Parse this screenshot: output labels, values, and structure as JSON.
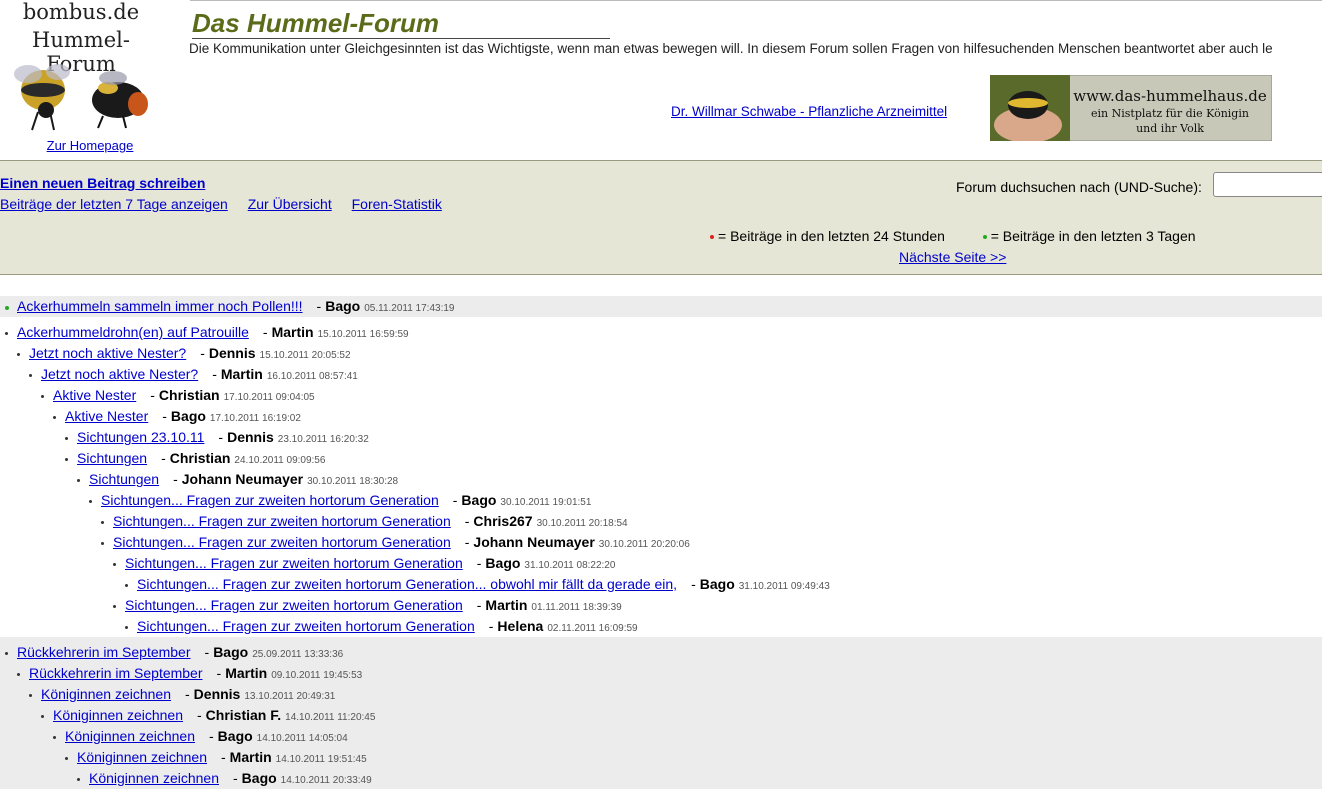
{
  "header": {
    "logo_line1": "bombus.de",
    "logo_line2": "Hummel-Forum",
    "home_link": "Zur Homepage",
    "title": "Das Hummel-Forum",
    "tagline": "Die Kommunikation unter Gleichgesinnten ist das Wichtigste, wenn man etwas bewegen will. In diesem Forum sollen Fragen von hilfesuchenden Menschen beantwortet aber auch le",
    "sponsor_link": "Dr. Willmar Schwabe - Pflanzliche Arzneimittel",
    "banner": {
      "line1": "www.das-hummelhaus.de",
      "line2": "ein Nistplatz für die Königin",
      "line3": "und ihr Volk"
    }
  },
  "toolbar": {
    "new_post": "Einen neuen Beitrag schreiben",
    "last7": "Beiträge der letzten 7 Tage anzeigen",
    "overview": "Zur Übersicht",
    "stats": "Foren-Statistik",
    "search_label": "Forum duchsuchen nach (UND-Suche):",
    "search_value": "",
    "legend_24h": "= Beiträge in den letzten 24 Stunden",
    "legend_3d": "= Beiträge in den letzten 3 Tagen",
    "next_page": "Nächste Seite >>"
  },
  "colors": {
    "new_24h": "#dd2222",
    "new_3d": "#22aa22",
    "title": "#5a6b1a",
    "toolbar_bg": "#e6e6d6"
  },
  "threads": [
    {
      "shaded": true,
      "posts": [
        {
          "depth": 0,
          "subject": "Ackerhummeln sammeln immer noch Pollen!!!",
          "author": "Bago",
          "date": "05.11.2011 17:43:19",
          "new": "3d"
        }
      ]
    },
    {
      "shaded": false,
      "posts": [
        {
          "depth": 0,
          "subject": "Ackerhummeldrohn(en) auf Patrouille",
          "author": "Martin",
          "date": "15.10.2011 16:59:59"
        },
        {
          "depth": 1,
          "subject": "Jetzt noch aktive Nester?",
          "author": "Dennis",
          "date": "15.10.2011 20:05:52"
        },
        {
          "depth": 2,
          "subject": "Jetzt noch aktive Nester?",
          "author": "Martin",
          "date": "16.10.2011 08:57:41"
        },
        {
          "depth": 3,
          "subject": "Aktive Nester",
          "author": "Christian",
          "date": "17.10.2011 09:04:05"
        },
        {
          "depth": 4,
          "subject": "Aktive Nester",
          "author": "Bago",
          "date": "17.10.2011 16:19:02"
        },
        {
          "depth": 5,
          "subject": "Sichtungen 23.10.11",
          "author": "Dennis",
          "date": "23.10.2011 16:20:32"
        },
        {
          "depth": 5,
          "subject": "Sichtungen",
          "author": "Christian",
          "date": "24.10.2011 09:09:56"
        },
        {
          "depth": 6,
          "subject": "Sichtungen",
          "author": "Johann Neumayer",
          "date": "30.10.2011 18:30:28"
        },
        {
          "depth": 7,
          "subject": "Sichtungen... Fragen zur zweiten hortorum Generation",
          "author": "Bago",
          "date": "30.10.2011 19:01:51"
        },
        {
          "depth": 8,
          "subject": "Sichtungen... Fragen zur zweiten hortorum Generation",
          "author": "Chris267",
          "date": "30.10.2011 20:18:54"
        },
        {
          "depth": 8,
          "subject": "Sichtungen... Fragen zur zweiten hortorum Generation",
          "author": "Johann Neumayer",
          "date": "30.10.2011 20:20:06"
        },
        {
          "depth": 9,
          "subject": "Sichtungen... Fragen zur zweiten hortorum Generation",
          "author": "Bago",
          "date": "31.10.2011 08:22:20"
        },
        {
          "depth": 10,
          "subject": "Sichtungen... Fragen zur zweiten hortorum Generation... obwohl mir fällt da gerade ein,",
          "author": "Bago",
          "date": "31.10.2011 09:49:43"
        },
        {
          "depth": 9,
          "subject": "Sichtungen... Fragen zur zweiten hortorum Generation",
          "author": "Martin",
          "date": "01.11.2011 18:39:39"
        },
        {
          "depth": 10,
          "subject": "Sichtungen... Fragen zur zweiten hortorum Generation",
          "author": "Helena",
          "date": "02.11.2011 16:09:59"
        }
      ]
    },
    {
      "shaded": true,
      "posts": [
        {
          "depth": 0,
          "subject": "Rückkehrerin im September",
          "author": "Bago",
          "date": "25.09.2011 13:33:36"
        },
        {
          "depth": 1,
          "subject": "Rückkehrerin im September",
          "author": "Martin",
          "date": "09.10.2011 19:45:53"
        },
        {
          "depth": 2,
          "subject": "Königinnen zeichnen",
          "author": "Dennis",
          "date": "13.10.2011 20:49:31"
        },
        {
          "depth": 3,
          "subject": "Königinnen zeichnen",
          "author": "Christian F.",
          "date": "14.10.2011 11:20:45"
        },
        {
          "depth": 4,
          "subject": "Königinnen zeichnen",
          "author": "Bago",
          "date": "14.10.2011 14:05:04"
        },
        {
          "depth": 5,
          "subject": "Königinnen zeichnen",
          "author": "Martin",
          "date": "14.10.2011 19:51:45"
        },
        {
          "depth": 6,
          "subject": "Königinnen zeichnen",
          "author": "Bago",
          "date": "14.10.2011 20:33:49"
        }
      ]
    }
  ]
}
